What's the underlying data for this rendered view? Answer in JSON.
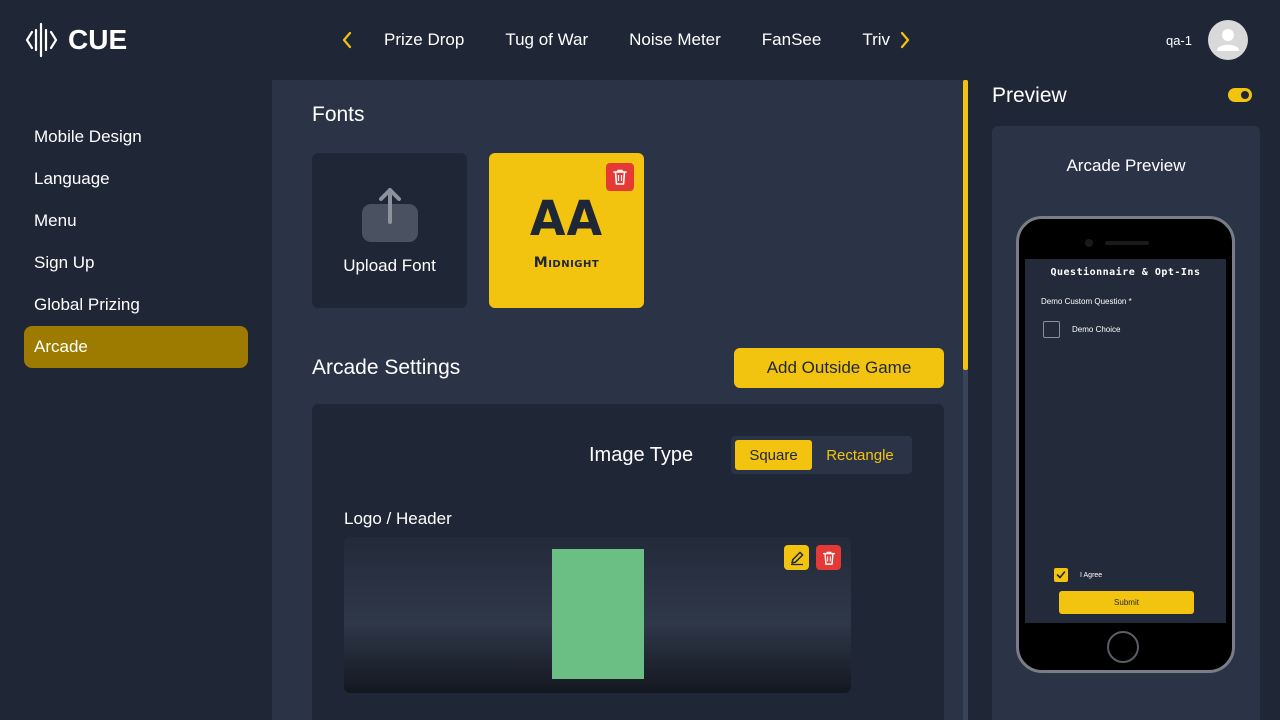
{
  "app": {
    "logo_text": "CUE"
  },
  "header": {
    "nav_items": [
      "Prize Drop",
      "Tug of War",
      "Noise Meter",
      "FanSee",
      "Trivia"
    ],
    "user_name": "qa-1"
  },
  "sidebar": {
    "items": [
      {
        "label": "Mobile Design"
      },
      {
        "label": "Language"
      },
      {
        "label": "Menu"
      },
      {
        "label": "Sign Up"
      },
      {
        "label": "Global Prizing"
      },
      {
        "label": "Arcade"
      }
    ],
    "active": "Arcade"
  },
  "main": {
    "fonts_title": "Fonts",
    "upload_font_label": "Upload Font",
    "font_preview_glyph": "AA",
    "font_name": "Midnight",
    "arcade_settings_title": "Arcade Settings",
    "add_outside_game_label": "Add Outside Game",
    "image_type_label": "Image Type",
    "image_type_options": [
      "Square",
      "Rectangle"
    ],
    "image_type_selected": "Square",
    "logo_header_label": "Logo / Header"
  },
  "preview": {
    "title": "Preview",
    "card_title": "Arcade Preview",
    "toggle_on": true,
    "screen": {
      "title": "Questionnaire & Opt-Ins",
      "question": "Demo Custom Question *",
      "choice": "Demo Choice",
      "agree": "I Agree",
      "submit": "Submit"
    }
  },
  "colors": {
    "accent": "#f2c40f",
    "active_nav": "#9d7a00",
    "danger": "#e53935",
    "bg_dark": "#1f2636",
    "bg_panel": "#2b3447"
  }
}
